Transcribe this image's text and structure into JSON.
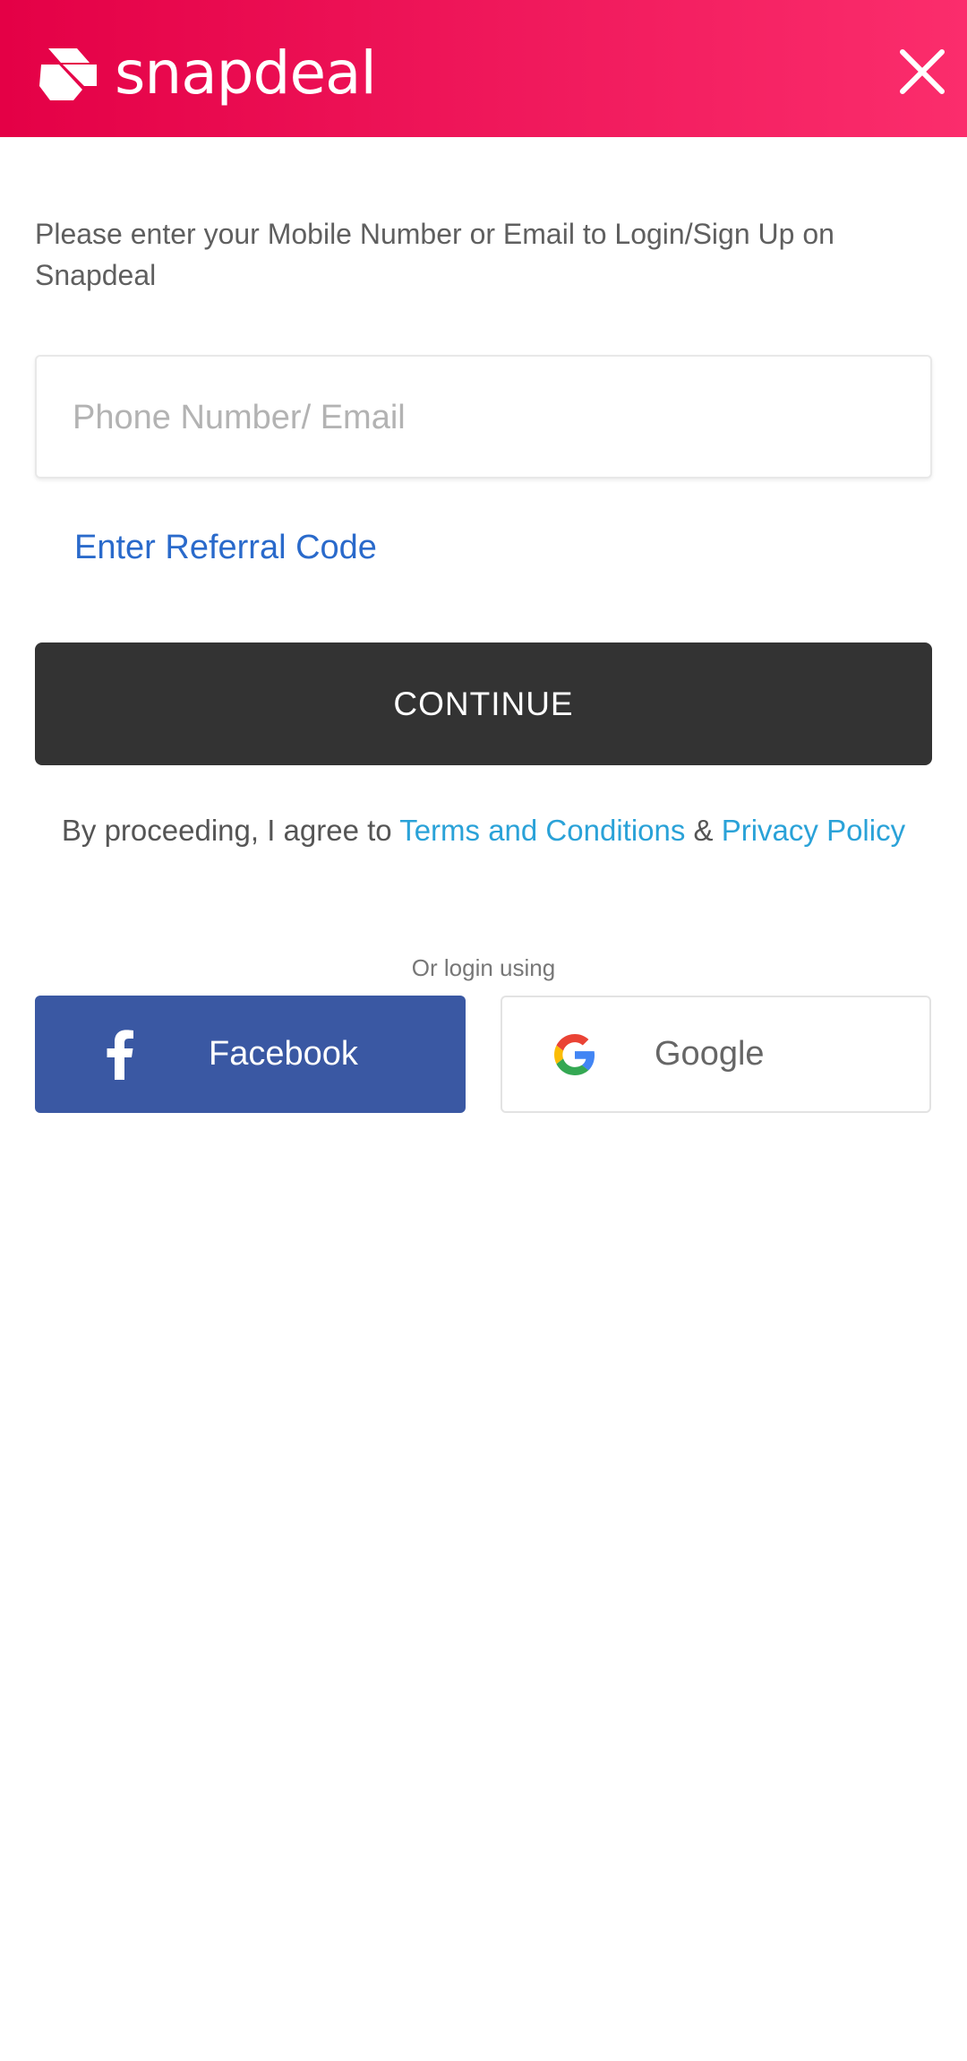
{
  "header": {
    "brand": "snapdeal",
    "background_color": "#e40046",
    "close_icon": "close-icon"
  },
  "instruction": "Please enter your Mobile Number or Email to Login/Sign Up on Snapdeal",
  "login_input": {
    "placeholder": "Phone Number/ Email",
    "value": ""
  },
  "referral_link": "Enter Referral Code",
  "continue_button": "CONTINUE",
  "terms": {
    "prefix": "By proceeding, I agree to ",
    "terms_link": "Terms and Conditions",
    "separator": " & ",
    "privacy_link": "Privacy Policy",
    "link_color": "#2aa2d8"
  },
  "social": {
    "or_text": "Or login using",
    "facebook_label": "Facebook",
    "facebook_color": "#3a58a3",
    "google_label": "Google"
  }
}
